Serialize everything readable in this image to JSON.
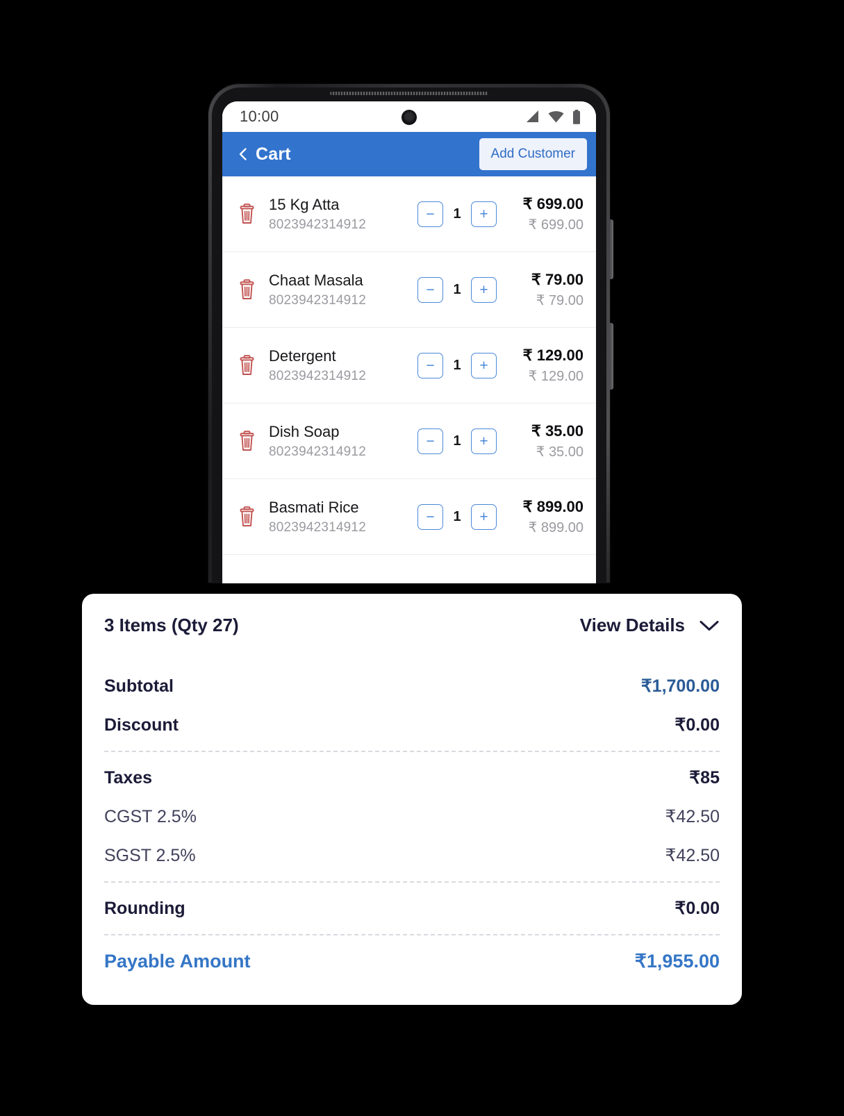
{
  "status_bar": {
    "time": "10:00",
    "icons": [
      "signal-icon",
      "wifi-icon",
      "battery-icon"
    ]
  },
  "app_bar": {
    "back_icon": "chevron-left-icon",
    "title": "Cart",
    "add_customer_label": "Add Customer"
  },
  "cart": {
    "items": [
      {
        "name": "15 Kg Atta",
        "sku": "8023942314912",
        "qty": "1",
        "price": "₹ 699.00",
        "line_total": "₹ 699.00",
        "decrement_label": "−",
        "increment_label": "+",
        "delete_icon": "trash-icon"
      },
      {
        "name": "Chaat Masala",
        "sku": "8023942314912",
        "qty": "1",
        "price": "₹ 79.00",
        "line_total": "₹ 79.00",
        "decrement_label": "−",
        "increment_label": "+",
        "delete_icon": "trash-icon"
      },
      {
        "name": "Detergent",
        "sku": "8023942314912",
        "qty": "1",
        "price": "₹ 129.00",
        "line_total": "₹ 129.00",
        "decrement_label": "−",
        "increment_label": "+",
        "delete_icon": "trash-icon"
      },
      {
        "name": "Dish Soap",
        "sku": "8023942314912",
        "qty": "1",
        "price": "₹ 35.00",
        "line_total": "₹ 35.00",
        "decrement_label": "−",
        "increment_label": "+",
        "delete_icon": "trash-icon"
      },
      {
        "name": "Basmati Rice",
        "sku": "8023942314912",
        "qty": "1",
        "price": "₹ 899.00",
        "line_total": "₹ 899.00",
        "decrement_label": "−",
        "increment_label": "+",
        "delete_icon": "trash-icon"
      }
    ]
  },
  "summary": {
    "items_count": "3 Items (Qty 27)",
    "view_details_label": "View Details",
    "chevron_icon": "chevron-down-icon",
    "subtotal_label": "Subtotal",
    "subtotal_value": "₹1,700.00",
    "discount_label": "Discount",
    "discount_value": "₹0.00",
    "taxes_label": "Taxes",
    "taxes_value": "₹85",
    "cgst_label": "CGST 2.5%",
    "cgst_value": "₹42.50",
    "sgst_label": "SGST 2.5%",
    "sgst_value": "₹42.50",
    "rounding_label": "Rounding",
    "rounding_value": "₹0.00",
    "payable_label": "Payable Amount",
    "payable_value": "₹1,955.00"
  },
  "colors": {
    "app_bar": "#3273cd",
    "accent_blue": "#3476c6",
    "trash_red": "#c0514f",
    "stepper_blue": "#4a88d8",
    "navy": "#1b1b38"
  }
}
